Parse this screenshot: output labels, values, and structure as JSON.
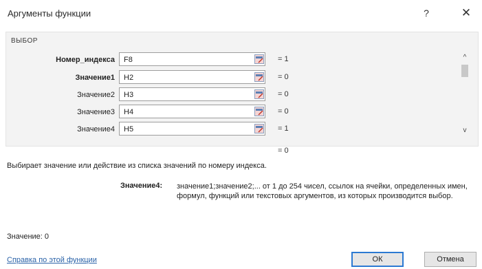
{
  "window": {
    "title": "Аргументы функции",
    "help": "?",
    "close": "✕"
  },
  "function_name": "ВЫБОР",
  "arguments": [
    {
      "label": "Номер_индекса",
      "value": "F8",
      "result": "= 1",
      "bold": true
    },
    {
      "label": "Значение1",
      "value": "H2",
      "result": "= 0",
      "bold": true
    },
    {
      "label": "Значение2",
      "value": "H3",
      "result": "= 0",
      "bold": false
    },
    {
      "label": "Значение3",
      "value": "H4",
      "result": "= 0",
      "bold": false
    },
    {
      "label": "Значение4",
      "value": "H5",
      "result": "= 1",
      "bold": false
    }
  ],
  "scroll": {
    "up": "^",
    "down": "v"
  },
  "total_result": "= 0",
  "description": "Выбирает значение или действие из списка значений по номеру индекса.",
  "arg_help": {
    "name": "Значение4:",
    "text": "значение1;значение2;... от 1 до 254 чисел, ссылок на ячейки, определенных имен, формул, функций или текстовых аргументов, из которых производится выбор."
  },
  "result_line": "Значение:  0",
  "help_link": "Справка по этой функции",
  "buttons": {
    "ok": "ОК",
    "cancel": "Отмена"
  },
  "colors": {
    "link": "#2a62a8",
    "ok_border": "#2b79d2",
    "panel": "#f3f3f3"
  }
}
